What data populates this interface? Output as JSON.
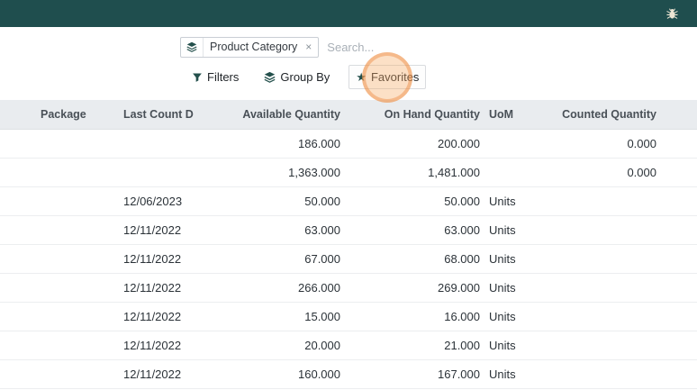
{
  "topbar": {
    "background_color": "#1f4e4e",
    "bug_icon": "debug-bug-icon"
  },
  "search": {
    "facet_icon": "category-layers-icon",
    "facet_label": "Product Category",
    "facet_remove": "×",
    "placeholder": "Search..."
  },
  "controls": {
    "filters_label": "Filters",
    "group_by_label": "Group By",
    "favorites_label": "Favorites",
    "star_glyph": "★",
    "highlight_color": "#ec8436"
  },
  "table": {
    "columns": [
      "Package",
      "Last Count Date",
      "Available Quantity",
      "On Hand Quantity",
      "UoM",
      "Counted Quantity"
    ],
    "rows": [
      {
        "package": "",
        "last_count_date": "",
        "available_quantity": "186.000",
        "on_hand_quantity": "200.000",
        "uom": "",
        "counted_quantity": "0.000"
      },
      {
        "package": "",
        "last_count_date": "",
        "available_quantity": "1,363.000",
        "on_hand_quantity": "1,481.000",
        "uom": "",
        "counted_quantity": "0.000"
      },
      {
        "package": "",
        "last_count_date": "12/06/2023",
        "available_quantity": "50.000",
        "on_hand_quantity": "50.000",
        "uom": "Units",
        "counted_quantity": ""
      },
      {
        "package": "",
        "last_count_date": "12/11/2022",
        "available_quantity": "63.000",
        "on_hand_quantity": "63.000",
        "uom": "Units",
        "counted_quantity": ""
      },
      {
        "package": "",
        "last_count_date": "12/11/2022",
        "available_quantity": "67.000",
        "on_hand_quantity": "68.000",
        "uom": "Units",
        "counted_quantity": ""
      },
      {
        "package": "",
        "last_count_date": "12/11/2022",
        "available_quantity": "266.000",
        "on_hand_quantity": "269.000",
        "uom": "Units",
        "counted_quantity": ""
      },
      {
        "package": "",
        "last_count_date": "12/11/2022",
        "available_quantity": "15.000",
        "on_hand_quantity": "16.000",
        "uom": "Units",
        "counted_quantity": ""
      },
      {
        "package": "",
        "last_count_date": "12/11/2022",
        "available_quantity": "20.000",
        "on_hand_quantity": "21.000",
        "uom": "Units",
        "counted_quantity": ""
      },
      {
        "package": "",
        "last_count_date": "12/11/2022",
        "available_quantity": "160.000",
        "on_hand_quantity": "167.000",
        "uom": "Units",
        "counted_quantity": ""
      }
    ]
  },
  "colors": {
    "accent_teal": "#1f4e4e",
    "header_band": "#e9ecef",
    "highlight_orange": "#ec8436"
  }
}
